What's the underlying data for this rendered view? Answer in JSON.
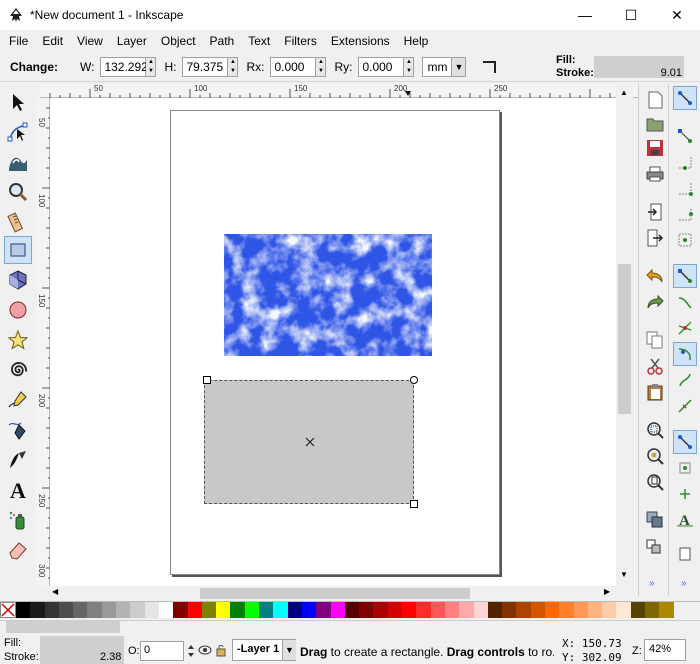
{
  "window": {
    "title": "*New document 1 - Inkscape",
    "minimize_glyph": "—",
    "maximize_glyph": "☐",
    "close_glyph": "✕"
  },
  "menu": {
    "items": [
      {
        "label": "File"
      },
      {
        "label": "Edit"
      },
      {
        "label": "View"
      },
      {
        "label": "Layer"
      },
      {
        "label": "Object"
      },
      {
        "label": "Path"
      },
      {
        "label": "Text"
      },
      {
        "label": "Filters"
      },
      {
        "label": "Extensions"
      },
      {
        "label": "Help"
      }
    ]
  },
  "controls": {
    "change_label": "Change:",
    "w_label": "W:",
    "w_value": "132.292",
    "h_label": "H:",
    "h_value": "79.375",
    "rx_label": "Rx:",
    "rx_value": "0.000",
    "ry_label": "Ry:",
    "ry_value": "0.000",
    "unit": "mm",
    "fill_label": "Fill:",
    "stroke_label": "Stroke:",
    "stroke_value": "9.01"
  },
  "ruler": {
    "h_labels": [
      "50",
      "100",
      "150",
      "200",
      "250"
    ],
    "v_labels": [
      "50",
      "100",
      "150",
      "200",
      "250",
      "300"
    ]
  },
  "tools": [
    {
      "name": "selector-icon"
    },
    {
      "name": "node-editor-icon"
    },
    {
      "name": "tweak-icon"
    },
    {
      "name": "zoom-icon"
    },
    {
      "name": "measure-icon"
    },
    {
      "name": "rectangle-icon"
    },
    {
      "name": "3d-box-icon"
    },
    {
      "name": "ellipse-icon"
    },
    {
      "name": "star-icon"
    },
    {
      "name": "spiral-icon"
    },
    {
      "name": "pencil-icon"
    },
    {
      "name": "pen-icon"
    },
    {
      "name": "calligraphy-icon"
    },
    {
      "name": "text-icon"
    },
    {
      "name": "spray-icon"
    },
    {
      "name": "eraser-icon"
    }
  ],
  "status": {
    "fill_label": "Fill:",
    "stroke_label": "Stroke:",
    "stroke_value": "2.38",
    "opacity_label": "O:",
    "opacity_value": "0",
    "layer": "-Layer 1",
    "message_bold1": "Drag",
    "message1": " to create a rectangle. ",
    "message_bold2": "Drag controls",
    "message2": " to ro...",
    "x_label": "X:",
    "x_value": "150.73",
    "y_label": "Y:",
    "y_value": "302.09",
    "zoom_label": "Z:",
    "zoom_value": "42%"
  },
  "palette": {
    "colors": [
      "#000000",
      "#1a1a1a",
      "#333333",
      "#4d4d4d",
      "#666666",
      "#808080",
      "#999999",
      "#b3b3b3",
      "#cccccc",
      "#e6e6e6",
      "#ffffff",
      "#800000",
      "#ff0000",
      "#808000",
      "#ffff00",
      "#008000",
      "#00ff00",
      "#008080",
      "#00ffff",
      "#000080",
      "#0000ff",
      "#800080",
      "#ff00ff",
      "#550000",
      "#800000",
      "#aa0000",
      "#d40000",
      "#ff0000",
      "#ff2a2a",
      "#ff5555",
      "#ff8080",
      "#ffaaaa",
      "#ffd5d5",
      "#552200",
      "#803300",
      "#aa4400",
      "#d45500",
      "#ff6600",
      "#ff7f2a",
      "#ff9955",
      "#ffb380",
      "#ffccaa",
      "#ffe6d5",
      "#554400",
      "#806600",
      "#aa8800"
    ]
  }
}
